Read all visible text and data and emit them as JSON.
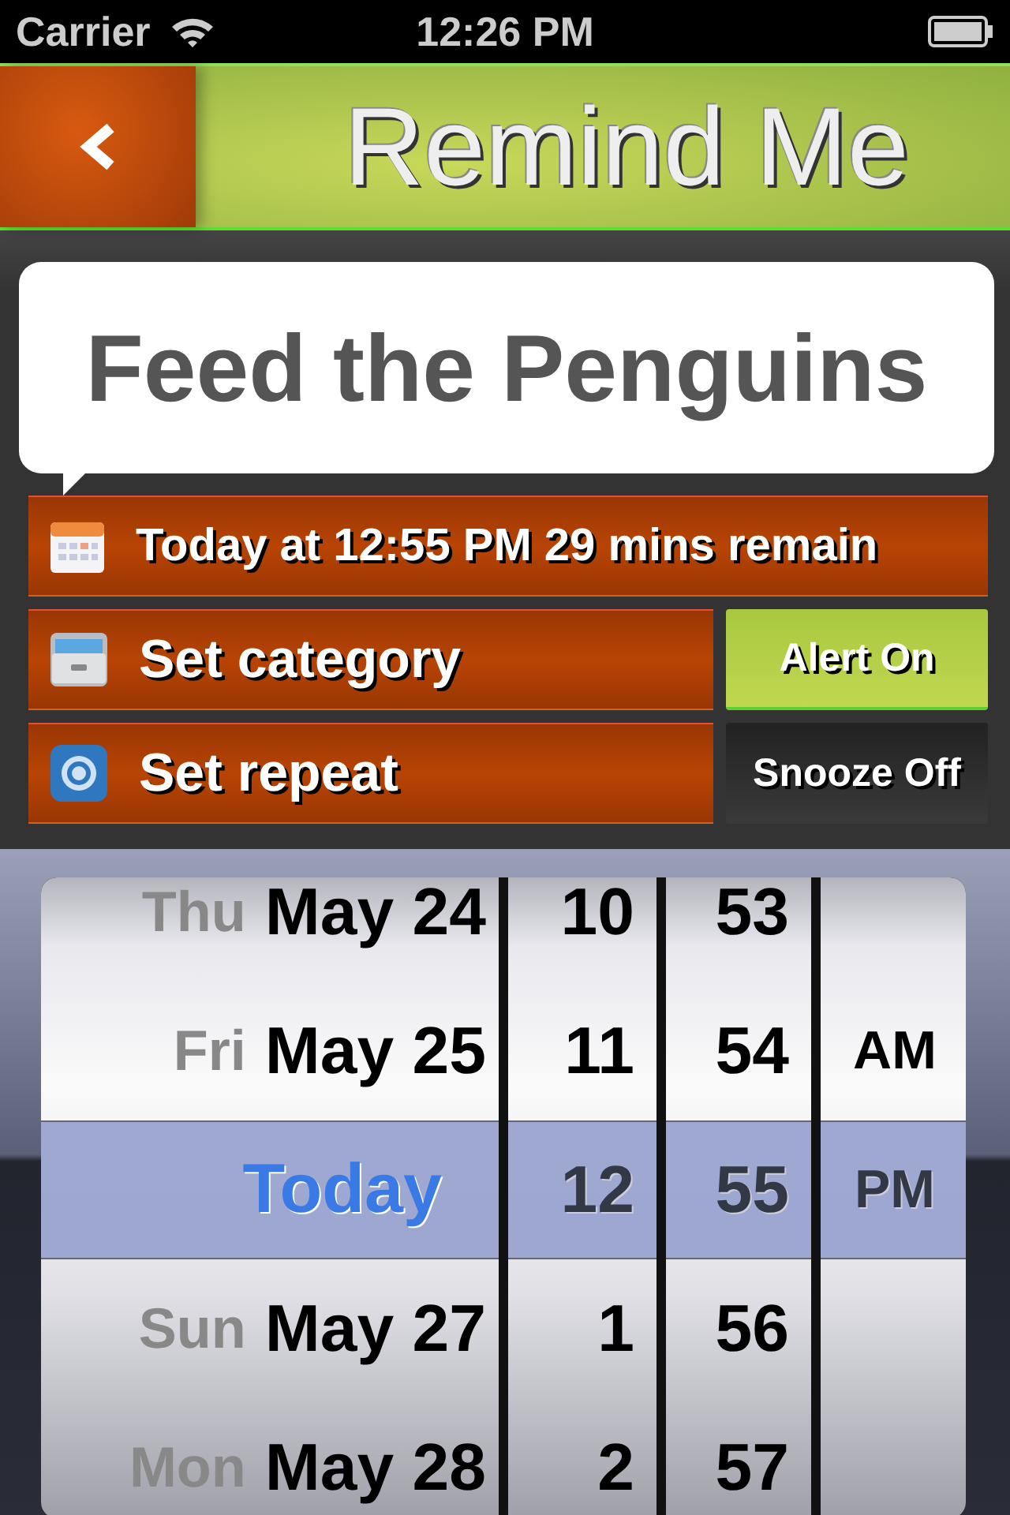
{
  "status_bar": {
    "carrier": "Carrier",
    "time": "12:26 PM"
  },
  "header": {
    "title": "Remind Me"
  },
  "reminder": {
    "title": "Feed the Penguins"
  },
  "due": {
    "text": "Today at 12:55 PM 29 mins remain"
  },
  "options": [
    {
      "label": "Set category",
      "kind": "drawer",
      "toggle": {
        "label": "Alert On",
        "on": true
      }
    },
    {
      "label": "Set repeat",
      "kind": "repeat",
      "toggle": {
        "label": "Snooze Off",
        "on": false
      }
    }
  ],
  "picker": {
    "columns": [
      {
        "kind": "date",
        "rows": [
          {
            "weekday": "Thu",
            "date": "May 24",
            "selected": false
          },
          {
            "weekday": "Fri",
            "date": "May 25",
            "selected": false
          },
          {
            "date": "Today",
            "selected": true
          },
          {
            "weekday": "Sun",
            "date": "May 27",
            "selected": false
          },
          {
            "weekday": "Mon",
            "date": "May 28",
            "selected": false
          }
        ]
      },
      {
        "kind": "number",
        "rows": [
          {
            "text": "10",
            "selected": false
          },
          {
            "text": "11",
            "selected": false
          },
          {
            "text": "12",
            "selected": true
          },
          {
            "text": "1",
            "selected": false
          },
          {
            "text": "2",
            "selected": false
          }
        ]
      },
      {
        "kind": "number",
        "rows": [
          {
            "text": "53",
            "selected": false
          },
          {
            "text": "54",
            "selected": false
          },
          {
            "text": "55",
            "selected": true
          },
          {
            "text": "56",
            "selected": false
          },
          {
            "text": "57",
            "selected": false
          }
        ]
      },
      {
        "kind": "ampm",
        "rows": [
          {
            "text": "AM",
            "selected": false
          },
          {
            "text": "PM",
            "selected": true
          }
        ]
      }
    ]
  }
}
